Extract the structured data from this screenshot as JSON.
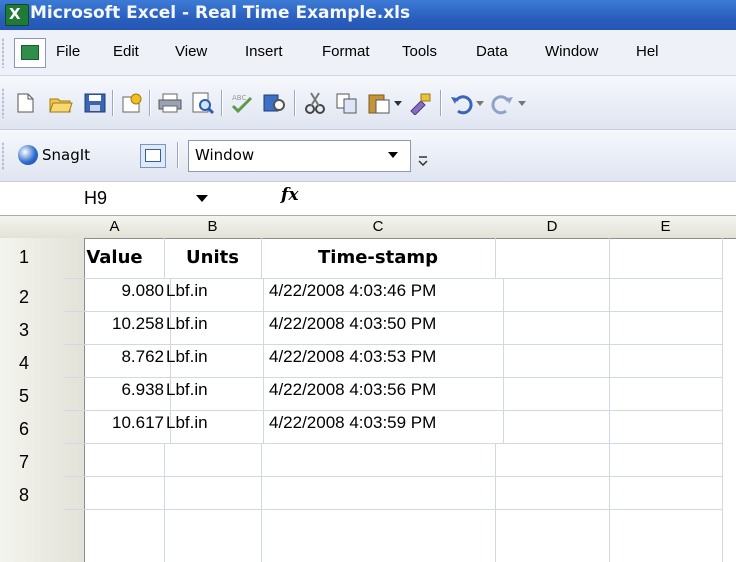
{
  "window": {
    "title": "Microsoft Excel - Real Time Example.xls",
    "app_icon": "X"
  },
  "menu": [
    "File",
    "Edit",
    "View",
    "Insert",
    "Format",
    "Tools",
    "Data",
    "Window",
    "Hel"
  ],
  "snagit": {
    "label": "SnagIt",
    "window_value": "Window"
  },
  "formula_bar": {
    "name_box": "H9",
    "fx": "fx",
    "formula": ""
  },
  "columns": [
    "A",
    "B",
    "C",
    "D",
    "E"
  ],
  "rows": [
    "1",
    "2",
    "3",
    "4",
    "5",
    "6",
    "7",
    "8"
  ],
  "table": {
    "headers": [
      "Value",
      "Units",
      "Time-stamp"
    ],
    "data": [
      [
        "9.080",
        "Lbf.in",
        "4/22/2008 4:03:46 PM"
      ],
      [
        "10.258",
        "Lbf.in",
        "4/22/2008 4:03:50 PM"
      ],
      [
        "8.762",
        "Lbf.in",
        "4/22/2008 4:03:53 PM"
      ],
      [
        "6.938",
        "Lbf.in",
        "4/22/2008 4:03:56 PM"
      ],
      [
        "10.617",
        "Lbf.in",
        "4/22/2008 4:03:59 PM"
      ]
    ]
  },
  "colors": {
    "titlebar": "#2a5fbf",
    "header_bg": "#e3e2d8",
    "gridline": "#d0d7e5"
  }
}
